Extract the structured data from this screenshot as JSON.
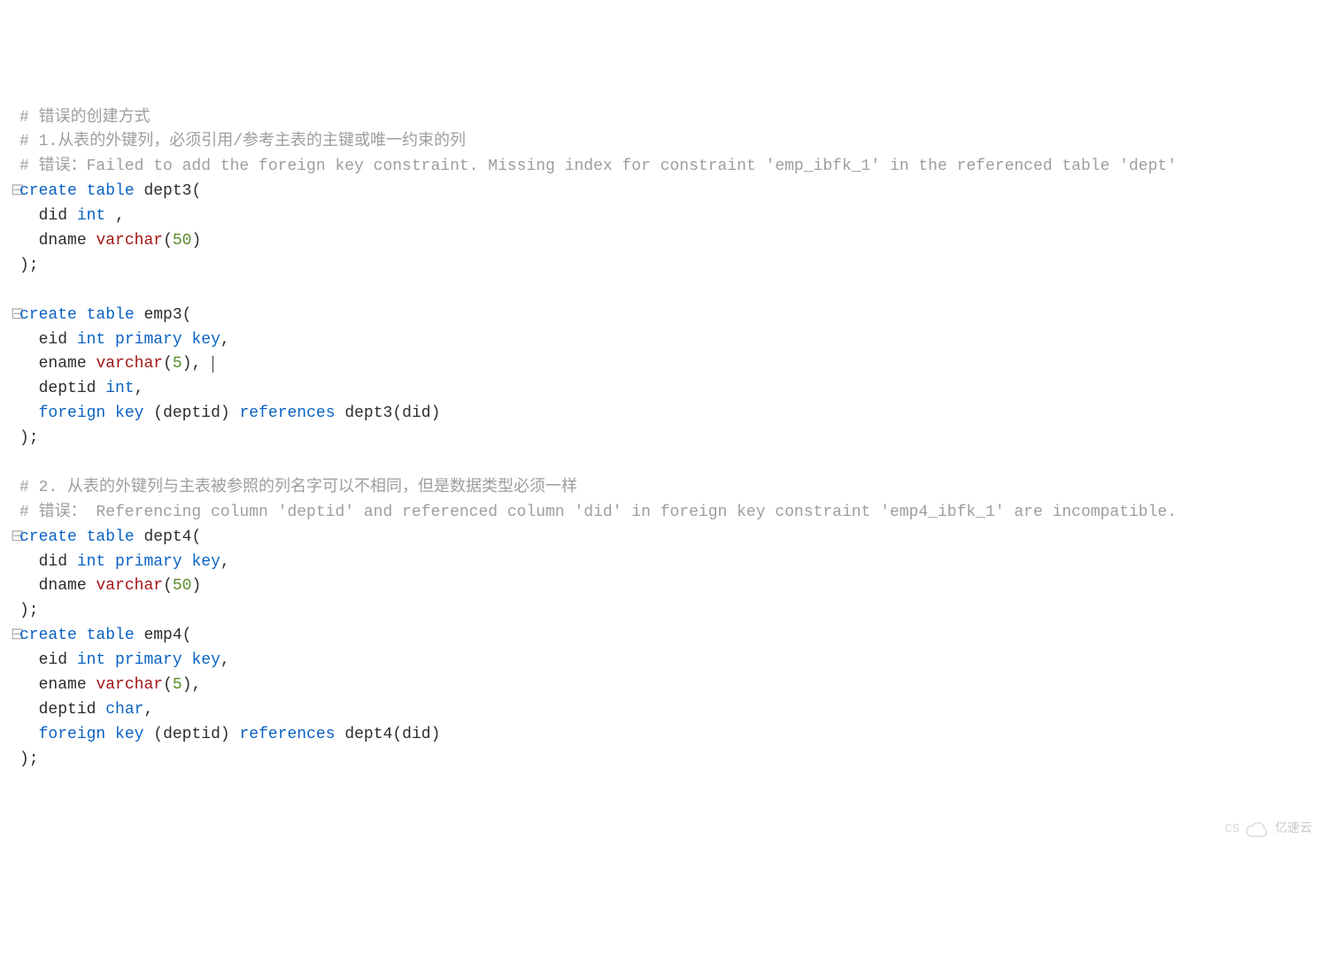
{
  "lines": [
    {
      "fold": " ",
      "tokens": [
        {
          "cls": "cmt",
          "t": "# 错误的创建方式"
        }
      ]
    },
    {
      "fold": " ",
      "tokens": [
        {
          "cls": "cmt",
          "t": "# 1.从表的外键列，必须引用/参考主表的主键或唯一约束的列"
        }
      ]
    },
    {
      "fold": " ",
      "tokens": [
        {
          "cls": "cmt",
          "t": "# 错误：Failed to add the foreign key constraint. Missing index for constraint 'emp_ibfk_1' in the referenced table 'dept'"
        }
      ]
    },
    {
      "fold": "⊟",
      "tokens": [
        {
          "cls": "kw",
          "t": "create"
        },
        {
          "cls": "pn",
          "t": " "
        },
        {
          "cls": "kw",
          "t": "table"
        },
        {
          "cls": "pn",
          "t": " "
        },
        {
          "cls": "id",
          "t": "dept3"
        },
        {
          "cls": "pn",
          "t": "("
        }
      ]
    },
    {
      "fold": " ",
      "tokens": [
        {
          "cls": "pn",
          "t": "  "
        },
        {
          "cls": "id",
          "t": "did"
        },
        {
          "cls": "pn",
          "t": " "
        },
        {
          "cls": "kw",
          "t": "int"
        },
        {
          "cls": "pn",
          "t": " ,"
        }
      ]
    },
    {
      "fold": " ",
      "tokens": [
        {
          "cls": "pn",
          "t": "  "
        },
        {
          "cls": "id",
          "t": "dname"
        },
        {
          "cls": "pn",
          "t": " "
        },
        {
          "cls": "fn",
          "t": "varchar"
        },
        {
          "cls": "pn",
          "t": "("
        },
        {
          "cls": "num",
          "t": "50"
        },
        {
          "cls": "pn",
          "t": ")"
        }
      ]
    },
    {
      "fold": " ",
      "tokens": [
        {
          "cls": "pn",
          "t": ");"
        }
      ]
    },
    {
      "fold": " ",
      "tokens": []
    },
    {
      "fold": "⊟",
      "tokens": [
        {
          "cls": "kw",
          "t": "create"
        },
        {
          "cls": "pn",
          "t": " "
        },
        {
          "cls": "kw",
          "t": "table"
        },
        {
          "cls": "pn",
          "t": " "
        },
        {
          "cls": "id",
          "t": "emp3"
        },
        {
          "cls": "pn",
          "t": "("
        }
      ]
    },
    {
      "fold": " ",
      "tokens": [
        {
          "cls": "pn",
          "t": "  "
        },
        {
          "cls": "id",
          "t": "eid"
        },
        {
          "cls": "pn",
          "t": " "
        },
        {
          "cls": "kw",
          "t": "int"
        },
        {
          "cls": "pn",
          "t": " "
        },
        {
          "cls": "kw",
          "t": "primary"
        },
        {
          "cls": "pn",
          "t": " "
        },
        {
          "cls": "kw",
          "t": "key"
        },
        {
          "cls": "pn",
          "t": ","
        }
      ]
    },
    {
      "fold": " ",
      "cursor": true,
      "tokens": [
        {
          "cls": "pn",
          "t": "  "
        },
        {
          "cls": "id",
          "t": "ename"
        },
        {
          "cls": "pn",
          "t": " "
        },
        {
          "cls": "fn",
          "t": "varchar"
        },
        {
          "cls": "pn",
          "t": "("
        },
        {
          "cls": "num",
          "t": "5"
        },
        {
          "cls": "pn",
          "t": "),"
        }
      ]
    },
    {
      "fold": " ",
      "tokens": [
        {
          "cls": "pn",
          "t": "  "
        },
        {
          "cls": "id",
          "t": "deptid"
        },
        {
          "cls": "pn",
          "t": " "
        },
        {
          "cls": "kw",
          "t": "int"
        },
        {
          "cls": "pn",
          "t": ","
        }
      ]
    },
    {
      "fold": " ",
      "tokens": [
        {
          "cls": "pn",
          "t": "  "
        },
        {
          "cls": "kw",
          "t": "foreign"
        },
        {
          "cls": "pn",
          "t": " "
        },
        {
          "cls": "kw",
          "t": "key"
        },
        {
          "cls": "pn",
          "t": " ("
        },
        {
          "cls": "id",
          "t": "deptid"
        },
        {
          "cls": "pn",
          "t": ") "
        },
        {
          "cls": "kw",
          "t": "references"
        },
        {
          "cls": "pn",
          "t": " "
        },
        {
          "cls": "id",
          "t": "dept3"
        },
        {
          "cls": "pn",
          "t": "("
        },
        {
          "cls": "id",
          "t": "did"
        },
        {
          "cls": "pn",
          "t": ")"
        }
      ]
    },
    {
      "fold": " ",
      "tokens": [
        {
          "cls": "pn",
          "t": ");"
        }
      ]
    },
    {
      "fold": " ",
      "tokens": []
    },
    {
      "fold": " ",
      "tokens": [
        {
          "cls": "cmt",
          "t": "# 2. 从表的外键列与主表被参照的列名字可以不相同，但是数据类型必须一样"
        }
      ]
    },
    {
      "fold": " ",
      "tokens": [
        {
          "cls": "cmt",
          "t": "# 错误： Referencing column 'deptid' and referenced column 'did' in foreign key constraint 'emp4_ibfk_1' are incompatible."
        }
      ]
    },
    {
      "fold": "⊟",
      "tokens": [
        {
          "cls": "kw",
          "t": "create"
        },
        {
          "cls": "pn",
          "t": " "
        },
        {
          "cls": "kw",
          "t": "table"
        },
        {
          "cls": "pn",
          "t": " "
        },
        {
          "cls": "id",
          "t": "dept4"
        },
        {
          "cls": "pn",
          "t": "("
        }
      ]
    },
    {
      "fold": " ",
      "tokens": [
        {
          "cls": "pn",
          "t": "  "
        },
        {
          "cls": "id",
          "t": "did"
        },
        {
          "cls": "pn",
          "t": " "
        },
        {
          "cls": "kw",
          "t": "int"
        },
        {
          "cls": "pn",
          "t": " "
        },
        {
          "cls": "kw",
          "t": "primary"
        },
        {
          "cls": "pn",
          "t": " "
        },
        {
          "cls": "kw",
          "t": "key"
        },
        {
          "cls": "pn",
          "t": ","
        }
      ]
    },
    {
      "fold": " ",
      "tokens": [
        {
          "cls": "pn",
          "t": "  "
        },
        {
          "cls": "id",
          "t": "dname"
        },
        {
          "cls": "pn",
          "t": " "
        },
        {
          "cls": "fn",
          "t": "varchar"
        },
        {
          "cls": "pn",
          "t": "("
        },
        {
          "cls": "num",
          "t": "50"
        },
        {
          "cls": "pn",
          "t": ")"
        }
      ]
    },
    {
      "fold": " ",
      "tokens": [
        {
          "cls": "pn",
          "t": ");"
        }
      ]
    },
    {
      "fold": "⊟",
      "tokens": [
        {
          "cls": "kw",
          "t": "create"
        },
        {
          "cls": "pn",
          "t": " "
        },
        {
          "cls": "kw",
          "t": "table"
        },
        {
          "cls": "pn",
          "t": " "
        },
        {
          "cls": "id",
          "t": "emp4"
        },
        {
          "cls": "pn",
          "t": "("
        }
      ]
    },
    {
      "fold": " ",
      "tokens": [
        {
          "cls": "pn",
          "t": "  "
        },
        {
          "cls": "id",
          "t": "eid"
        },
        {
          "cls": "pn",
          "t": " "
        },
        {
          "cls": "kw",
          "t": "int"
        },
        {
          "cls": "pn",
          "t": " "
        },
        {
          "cls": "kw",
          "t": "primary"
        },
        {
          "cls": "pn",
          "t": " "
        },
        {
          "cls": "kw",
          "t": "key"
        },
        {
          "cls": "pn",
          "t": ","
        }
      ]
    },
    {
      "fold": " ",
      "tokens": [
        {
          "cls": "pn",
          "t": "  "
        },
        {
          "cls": "id",
          "t": "ename"
        },
        {
          "cls": "pn",
          "t": " "
        },
        {
          "cls": "fn",
          "t": "varchar"
        },
        {
          "cls": "pn",
          "t": "("
        },
        {
          "cls": "num",
          "t": "5"
        },
        {
          "cls": "pn",
          "t": "),"
        }
      ]
    },
    {
      "fold": " ",
      "tokens": [
        {
          "cls": "pn",
          "t": "  "
        },
        {
          "cls": "id",
          "t": "deptid"
        },
        {
          "cls": "pn",
          "t": " "
        },
        {
          "cls": "kw",
          "t": "char"
        },
        {
          "cls": "pn",
          "t": ","
        }
      ]
    },
    {
      "fold": " ",
      "tokens": [
        {
          "cls": "pn",
          "t": "  "
        },
        {
          "cls": "kw",
          "t": "foreign"
        },
        {
          "cls": "pn",
          "t": " "
        },
        {
          "cls": "kw",
          "t": "key"
        },
        {
          "cls": "pn",
          "t": " ("
        },
        {
          "cls": "id",
          "t": "deptid"
        },
        {
          "cls": "pn",
          "t": ") "
        },
        {
          "cls": "kw",
          "t": "references"
        },
        {
          "cls": "pn",
          "t": " "
        },
        {
          "cls": "id",
          "t": "dept4"
        },
        {
          "cls": "pn",
          "t": "("
        },
        {
          "cls": "id",
          "t": "did"
        },
        {
          "cls": "pn",
          "t": ")"
        }
      ]
    },
    {
      "fold": " ",
      "tokens": [
        {
          "cls": "pn",
          "t": ");"
        }
      ]
    }
  ],
  "watermark_left": "CS",
  "watermark_right": "亿速云"
}
